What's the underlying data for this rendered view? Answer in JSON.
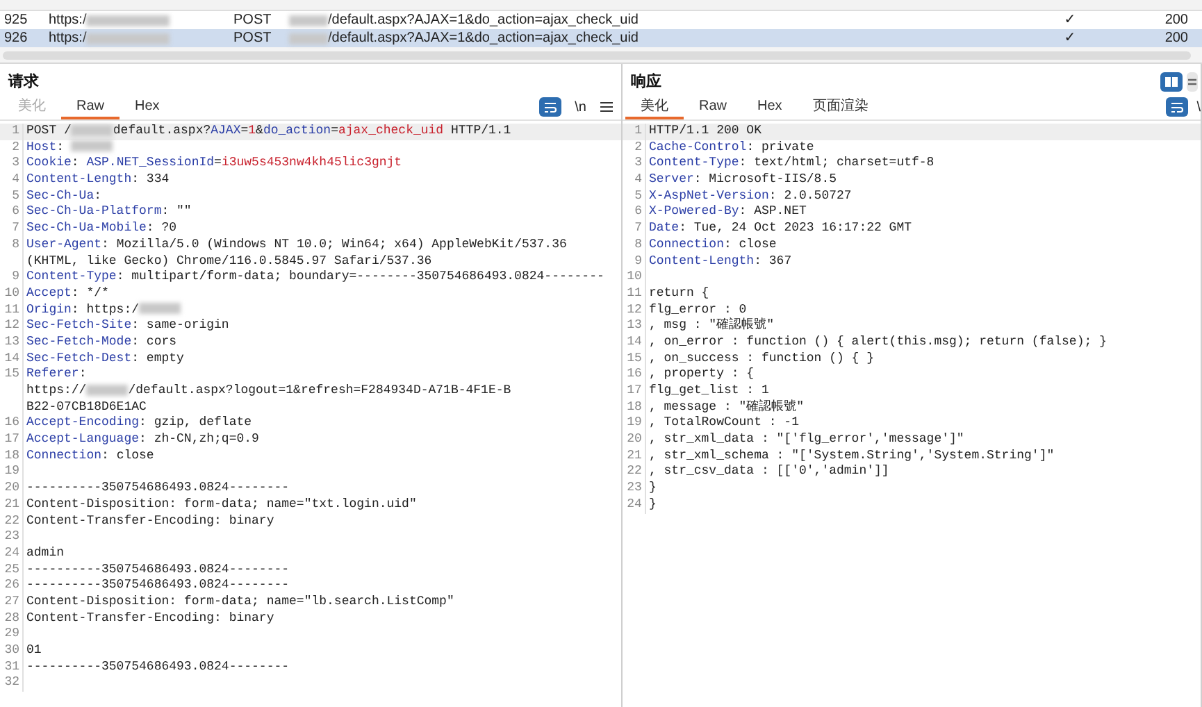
{
  "history": {
    "rows": [
      {
        "number": "925",
        "host": "https:/",
        "method": "POST",
        "url": "/default.aspx?AJAX=1&do_action=ajax_check_uid",
        "params": "✓",
        "status": "200",
        "selected": false
      },
      {
        "number": "926",
        "host": "https:/",
        "method": "POST",
        "url": "/default.aspx?AJAX=1&do_action=ajax_check_uid",
        "params": "✓",
        "status": "200",
        "selected": true
      }
    ]
  },
  "request": {
    "title": "请求",
    "tabs": [
      {
        "label": "美化",
        "selected": false,
        "disabled": true
      },
      {
        "label": "Raw",
        "selected": true,
        "disabled": false
      },
      {
        "label": "Hex",
        "selected": false,
        "disabled": false
      }
    ],
    "newline_toggle": "\\n",
    "lines": [
      {
        "no": "1",
        "segments": [
          {
            "kind": "plain",
            "text": "POST /"
          },
          {
            "kind": "redacted"
          },
          {
            "kind": "plain",
            "text": "default.aspx?"
          },
          {
            "kind": "key",
            "text": "AJAX"
          },
          {
            "kind": "plain",
            "text": "="
          },
          {
            "kind": "value",
            "text": "1"
          },
          {
            "kind": "plain",
            "text": "&"
          },
          {
            "kind": "key",
            "text": "do_action"
          },
          {
            "kind": "plain",
            "text": "="
          },
          {
            "kind": "value",
            "text": "ajax_check_uid"
          },
          {
            "kind": "plain",
            "text": " HTTP/1.1"
          }
        ]
      },
      {
        "no": "2",
        "segments": [
          {
            "kind": "key",
            "text": "Host"
          },
          {
            "kind": "plain",
            "text": ": "
          },
          {
            "kind": "redacted"
          }
        ]
      },
      {
        "no": "3",
        "segments": [
          {
            "kind": "key",
            "text": "Cookie"
          },
          {
            "kind": "plain",
            "text": ": "
          },
          {
            "kind": "key",
            "text": "ASP.NET_SessionId"
          },
          {
            "kind": "plain",
            "text": "="
          },
          {
            "kind": "value",
            "text": "i3uw5s453nw4kh45lic3gnjt"
          }
        ]
      },
      {
        "no": "4",
        "segments": [
          {
            "kind": "key",
            "text": "Content-Length"
          },
          {
            "kind": "plain",
            "text": ": 334"
          }
        ]
      },
      {
        "no": "5",
        "segments": [
          {
            "kind": "key",
            "text": "Sec-Ch-Ua"
          },
          {
            "kind": "plain",
            "text": ":"
          }
        ]
      },
      {
        "no": "6",
        "segments": [
          {
            "kind": "key",
            "text": "Sec-Ch-Ua-Platform"
          },
          {
            "kind": "plain",
            "text": ": \"\""
          }
        ]
      },
      {
        "no": "7",
        "segments": [
          {
            "kind": "key",
            "text": "Sec-Ch-Ua-Mobile"
          },
          {
            "kind": "plain",
            "text": ": ?0"
          }
        ]
      },
      {
        "no": "8",
        "segments": [
          {
            "kind": "key",
            "text": "User-Agent"
          },
          {
            "kind": "plain",
            "text": ": Mozilla/5.0 (Windows NT 10.0; Win64; x64) AppleWebKit/537.36"
          }
        ]
      },
      {
        "segments": [
          {
            "kind": "plain",
            "text": "(KHTML, like Gecko) Chrome/116.0.5845.97 Safari/537.36"
          }
        ]
      },
      {
        "no": "9",
        "segments": [
          {
            "kind": "key",
            "text": "Content-Type"
          },
          {
            "kind": "plain",
            "text": ": multipart/form-data; boundary=--------350754686493.0824--------"
          }
        ]
      },
      {
        "no": "10",
        "segments": [
          {
            "kind": "key",
            "text": "Accept"
          },
          {
            "kind": "plain",
            "text": ": */*"
          }
        ]
      },
      {
        "no": "11",
        "segments": [
          {
            "kind": "key",
            "text": "Origin"
          },
          {
            "kind": "plain",
            "text": ": https:/"
          },
          {
            "kind": "redacted"
          }
        ]
      },
      {
        "no": "12",
        "segments": [
          {
            "kind": "key",
            "text": "Sec-Fetch-Site"
          },
          {
            "kind": "plain",
            "text": ": same-origin"
          }
        ]
      },
      {
        "no": "13",
        "segments": [
          {
            "kind": "key",
            "text": "Sec-Fetch-Mode"
          },
          {
            "kind": "plain",
            "text": ": cors"
          }
        ]
      },
      {
        "no": "14",
        "segments": [
          {
            "kind": "key",
            "text": "Sec-Fetch-Dest"
          },
          {
            "kind": "plain",
            "text": ": empty"
          }
        ]
      },
      {
        "no": "15",
        "segments": [
          {
            "kind": "key",
            "text": "Referer"
          },
          {
            "kind": "plain",
            "text": ":"
          }
        ]
      },
      {
        "segments": [
          {
            "kind": "plain",
            "text": "https://"
          },
          {
            "kind": "redacted"
          },
          {
            "kind": "plain",
            "text": "/default.aspx?logout=1&refresh=F284934D-A71B-4F1E-B"
          }
        ]
      },
      {
        "segments": [
          {
            "kind": "plain",
            "text": "B22-07CB18D6E1AC"
          }
        ]
      },
      {
        "no": "16",
        "segments": [
          {
            "kind": "key",
            "text": "Accept-Encoding"
          },
          {
            "kind": "plain",
            "text": ": gzip, deflate"
          }
        ]
      },
      {
        "no": "17",
        "segments": [
          {
            "kind": "key",
            "text": "Accept-Language"
          },
          {
            "kind": "plain",
            "text": ": zh-CN,zh;q=0.9"
          }
        ]
      },
      {
        "no": "18",
        "segments": [
          {
            "kind": "key",
            "text": "Connection"
          },
          {
            "kind": "plain",
            "text": ": close"
          }
        ]
      },
      {
        "no": "19"
      },
      {
        "no": "20",
        "segments": [
          {
            "kind": "plain",
            "text": "----------350754686493.0824--------"
          }
        ]
      },
      {
        "no": "21",
        "segments": [
          {
            "kind": "plain",
            "text": "Content-Disposition: form-data; name=\"txt.login.uid\""
          }
        ]
      },
      {
        "no": "22",
        "segments": [
          {
            "kind": "plain",
            "text": "Content-Transfer-Encoding: binary"
          }
        ]
      },
      {
        "no": "23"
      },
      {
        "no": "24",
        "segments": [
          {
            "kind": "plain",
            "text": "admin"
          }
        ]
      },
      {
        "no": "25",
        "segments": [
          {
            "kind": "plain",
            "text": "----------350754686493.0824--------"
          }
        ]
      },
      {
        "no": "26",
        "segments": [
          {
            "kind": "plain",
            "text": "----------350754686493.0824--------"
          }
        ]
      },
      {
        "no": "27",
        "segments": [
          {
            "kind": "plain",
            "text": "Content-Disposition: form-data; name=\"lb.search.ListComp\""
          }
        ]
      },
      {
        "no": "28",
        "segments": [
          {
            "kind": "plain",
            "text": "Content-Transfer-Encoding: binary"
          }
        ]
      },
      {
        "no": "29"
      },
      {
        "no": "30",
        "segments": [
          {
            "kind": "plain",
            "text": "01"
          }
        ]
      },
      {
        "no": "31",
        "segments": [
          {
            "kind": "plain",
            "text": "----------350754686493.0824--------"
          }
        ]
      },
      {
        "no": "32"
      }
    ]
  },
  "response": {
    "title": "响应",
    "tabs": [
      {
        "label": "美化",
        "selected": true,
        "disabled": false
      },
      {
        "label": "Raw",
        "selected": false,
        "disabled": false
      },
      {
        "label": "Hex",
        "selected": false,
        "disabled": false
      },
      {
        "label": "页面渲染",
        "selected": false,
        "disabled": false
      }
    ],
    "newline_toggle": "\\",
    "lines": [
      {
        "no": "1",
        "segments": [
          {
            "kind": "plain",
            "text": "HTTP/1.1 200 OK"
          }
        ]
      },
      {
        "no": "2",
        "segments": [
          {
            "kind": "key",
            "text": "Cache-Control"
          },
          {
            "kind": "plain",
            "text": ": private"
          }
        ]
      },
      {
        "no": "3",
        "segments": [
          {
            "kind": "key",
            "text": "Content-Type"
          },
          {
            "kind": "plain",
            "text": ": text/html; charset=utf-8"
          }
        ]
      },
      {
        "no": "4",
        "segments": [
          {
            "kind": "key",
            "text": "Server"
          },
          {
            "kind": "plain",
            "text": ": Microsoft-IIS/8.5"
          }
        ]
      },
      {
        "no": "5",
        "segments": [
          {
            "kind": "key",
            "text": "X-AspNet-Version"
          },
          {
            "kind": "plain",
            "text": ": 2.0.50727"
          }
        ]
      },
      {
        "no": "6",
        "segments": [
          {
            "kind": "key",
            "text": "X-Powered-By"
          },
          {
            "kind": "plain",
            "text": ": ASP.NET"
          }
        ]
      },
      {
        "no": "7",
        "segments": [
          {
            "kind": "key",
            "text": "Date"
          },
          {
            "kind": "plain",
            "text": ": Tue, 24 Oct 2023 16:17:22 GMT"
          }
        ]
      },
      {
        "no": "8",
        "segments": [
          {
            "kind": "key",
            "text": "Connection"
          },
          {
            "kind": "plain",
            "text": ": close"
          }
        ]
      },
      {
        "no": "9",
        "segments": [
          {
            "kind": "key",
            "text": "Content-Length"
          },
          {
            "kind": "plain",
            "text": ": 367"
          }
        ]
      },
      {
        "no": "10"
      },
      {
        "no": "11",
        "segments": [
          {
            "kind": "plain",
            "text": "return {"
          }
        ]
      },
      {
        "no": "12",
        "segments": [
          {
            "kind": "plain",
            "text": "flg_error : 0"
          }
        ]
      },
      {
        "no": "13",
        "segments": [
          {
            "kind": "plain",
            "text": ", msg : \"確認帳號\""
          }
        ]
      },
      {
        "no": "14",
        "segments": [
          {
            "kind": "plain",
            "text": ", on_error : function () { alert(this.msg); return (false); }"
          }
        ]
      },
      {
        "no": "15",
        "segments": [
          {
            "kind": "plain",
            "text": ", on_success : function () { }"
          }
        ]
      },
      {
        "no": "16",
        "segments": [
          {
            "kind": "plain",
            "text": ", property : {"
          }
        ]
      },
      {
        "no": "17",
        "segments": [
          {
            "kind": "plain",
            "text": "flg_get_list : 1"
          }
        ]
      },
      {
        "no": "18",
        "segments": [
          {
            "kind": "plain",
            "text": ", message : \"確認帳號\""
          }
        ]
      },
      {
        "no": "19",
        "segments": [
          {
            "kind": "plain",
            "text": ", TotalRowCount : -1"
          }
        ]
      },
      {
        "no": "20",
        "segments": [
          {
            "kind": "plain",
            "text": ", str_xml_data : \"['flg_error','message']\""
          }
        ]
      },
      {
        "no": "21",
        "segments": [
          {
            "kind": "plain",
            "text": ", str_xml_schema : \"['System.String','System.String']\""
          }
        ]
      },
      {
        "no": "22",
        "segments": [
          {
            "kind": "plain",
            "text": ", str_csv_data : [['0','admin']]"
          }
        ]
      },
      {
        "no": "23",
        "segments": [
          {
            "kind": "plain",
            "text": "}"
          }
        ]
      },
      {
        "no": "24",
        "segments": [
          {
            "kind": "plain",
            "text": "}"
          }
        ]
      }
    ]
  }
}
